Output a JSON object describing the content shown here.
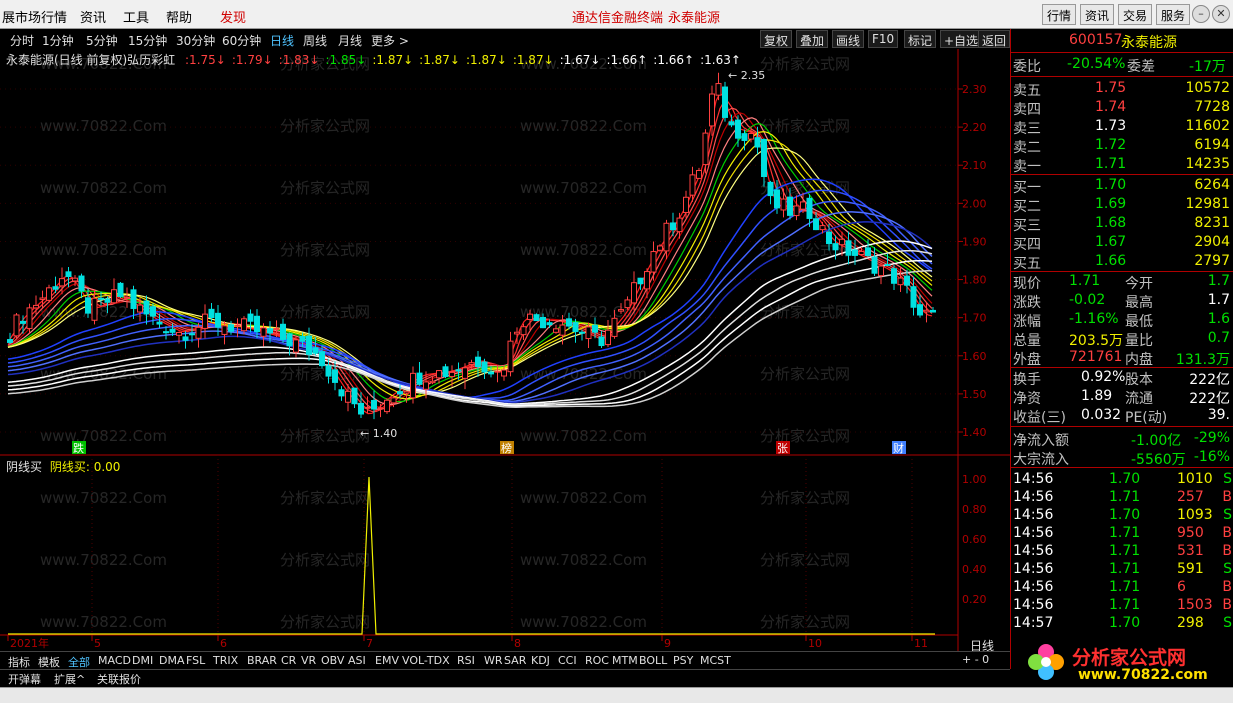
{
  "menu": {
    "title": "展市场行情",
    "items": [
      "资讯",
      "工具",
      "帮助"
    ],
    "highlight": "发现",
    "center1": "通达信金融终端",
    "center2": "永泰能源",
    "right_buttons": [
      "行情",
      "资讯",
      "交易",
      "服务"
    ]
  },
  "toolbar": {
    "periods": [
      "分时",
      "1分钟",
      "5分钟",
      "15分钟",
      "30分钟",
      "60分钟",
      "日线",
      "周线",
      "月线",
      "更多 >"
    ],
    "active": "日线",
    "buttons": [
      "复权",
      "叠加",
      "画线",
      "F10",
      "标记",
      "+自选",
      "返回"
    ]
  },
  "chart_title": "永泰能源(日线 前复权)弘历彩虹",
  "rainbow_values": [
    {
      "v": "1.75",
      "dir": "down",
      "c": "#ff4040"
    },
    {
      "v": "1.79",
      "dir": "down",
      "c": "#ff4040"
    },
    {
      "v": "1.83",
      "dir": "down",
      "c": "#ff4040"
    },
    {
      "v": "1.85",
      "dir": "down",
      "c": "#00e000"
    },
    {
      "v": "1.87",
      "dir": "down",
      "c": "#f0f000"
    },
    {
      "v": "1.87",
      "dir": "down",
      "c": "#f0f000"
    },
    {
      "v": "1.87",
      "dir": "down",
      "c": "#f0f000"
    },
    {
      "v": "1.87",
      "dir": "down",
      "c": "#f0f000"
    },
    {
      "v": "1.67",
      "dir": "down",
      "c": "#ffffff"
    },
    {
      "v": "1.66",
      "dir": "up",
      "c": "#ffffff"
    },
    {
      "v": "1.66",
      "dir": "up",
      "c": "#ffffff"
    },
    {
      "v": "1.63",
      "dir": "up",
      "c": "#ffffff"
    }
  ],
  "price_axis": [
    "2.30",
    "2.20",
    "2.10",
    "2.00",
    "1.90",
    "1.80",
    "1.70",
    "1.60",
    "1.50",
    "1.40"
  ],
  "annotations": {
    "high": "2.35",
    "low": "1.40"
  },
  "event_badges": [
    {
      "label": "跌",
      "color": "#00c000"
    },
    {
      "label": "榜",
      "color": "#c08000"
    },
    {
      "label": "张",
      "color": "#c00000"
    },
    {
      "label": "财",
      "color": "#4080ff"
    }
  ],
  "indicator": {
    "name": "阴线买",
    "label": "阴线买:",
    "value": "0.00",
    "axis": [
      "1.00",
      "0.80",
      "0.60",
      "0.40",
      "0.20"
    ]
  },
  "date_axis": [
    "2021年",
    "5",
    "6",
    "7",
    "8",
    "9",
    "10",
    "11"
  ],
  "period_label": "日线",
  "tabs": [
    "指标",
    "模板",
    "全部",
    "MACD",
    "DMI",
    "DMA",
    "FSL",
    "TRIX",
    "BRAR",
    "CR",
    "VR",
    "OBV",
    "ASI",
    "EMV",
    "VOL-TDX",
    "RSI",
    "WR",
    "SAR",
    "KDJ",
    "CCI",
    "ROC",
    "MTM",
    "BOLL",
    "PSY",
    "MCST"
  ],
  "bottom_buttons": [
    "开弹幕",
    "扩展^",
    "关联报价"
  ],
  "stock": {
    "code": "600157",
    "name": "永泰能源"
  },
  "weibi": {
    "label": "委比",
    "value": "-20.54%",
    "label2": "委差",
    "value2": "-17万"
  },
  "asks": [
    {
      "label": "卖五",
      "price": "1.75",
      "vol": "10572"
    },
    {
      "label": "卖四",
      "price": "1.74",
      "vol": "7728"
    },
    {
      "label": "卖三",
      "price": "1.73",
      "vol": "11602"
    },
    {
      "label": "卖二",
      "price": "1.72",
      "vol": "6194"
    },
    {
      "label": "卖一",
      "price": "1.71",
      "vol": "14235"
    }
  ],
  "bids": [
    {
      "label": "买一",
      "price": "1.70",
      "vol": "6264"
    },
    {
      "label": "买二",
      "price": "1.69",
      "vol": "12981"
    },
    {
      "label": "买三",
      "price": "1.68",
      "vol": "8231"
    },
    {
      "label": "买四",
      "price": "1.67",
      "vol": "2904"
    },
    {
      "label": "买五",
      "price": "1.66",
      "vol": "2797"
    }
  ],
  "quote": [
    {
      "l1": "现价",
      "v1": "1.71",
      "c1": "green",
      "l2": "今开",
      "v2": "1.7",
      "c2": "green"
    },
    {
      "l1": "涨跌",
      "v1": "-0.02",
      "c1": "green",
      "l2": "最高",
      "v2": "1.7",
      "c2": "white"
    },
    {
      "l1": "涨幅",
      "v1": "-1.16%",
      "c1": "green",
      "l2": "最低",
      "v2": "1.6",
      "c2": "green"
    },
    {
      "l1": "总量",
      "v1": "203.5万",
      "c1": "yellow",
      "l2": "量比",
      "v2": "0.7",
      "c2": "green"
    },
    {
      "l1": "外盘",
      "v1": "721761",
      "c1": "red",
      "l2": "内盘",
      "v2": "131.3万",
      "c2": "green"
    }
  ],
  "fund": [
    {
      "l1": "换手",
      "v1": "0.92%",
      "l2": "股本",
      "v2": "222亿"
    },
    {
      "l1": "净资",
      "v1": "1.89",
      "l2": "流通",
      "v2": "222亿"
    },
    {
      "l1": "收益(三)",
      "v1": "0.032",
      "l2": "PE(动)",
      "v2": "39."
    }
  ],
  "flow": [
    {
      "l": "净流入额",
      "v": "-1.00亿",
      "p": "-29%"
    },
    {
      "l": "大宗流入",
      "v": "-5560万",
      "p": "-16%"
    }
  ],
  "ticks": [
    {
      "t": "14:56",
      "p": "1.70",
      "v": "1010",
      "s": "S"
    },
    {
      "t": "14:56",
      "p": "1.71",
      "v": "257",
      "s": "B"
    },
    {
      "t": "14:56",
      "p": "1.70",
      "v": "1093",
      "s": "S"
    },
    {
      "t": "14:56",
      "p": "1.71",
      "v": "950",
      "s": "B"
    },
    {
      "t": "14:56",
      "p": "1.71",
      "v": "531",
      "s": "B"
    },
    {
      "t": "14:56",
      "p": "1.71",
      "v": "591",
      "s": "S"
    },
    {
      "t": "14:56",
      "p": "1.71",
      "v": "6",
      "s": "B"
    },
    {
      "t": "14:56",
      "p": "1.71",
      "v": "1503",
      "s": "B"
    },
    {
      "t": "14:57",
      "p": "1.70",
      "v": "298",
      "s": "S"
    }
  ],
  "logo": {
    "text": "分析家公式网",
    "url": "www.70822.com"
  },
  "watermark": {
    "site": "www.70822.Com",
    "cn": "分析家公式网"
  },
  "colors": {
    "up": "#ff4040",
    "down": "#00e0e0",
    "axis_red": "#b00000"
  }
}
